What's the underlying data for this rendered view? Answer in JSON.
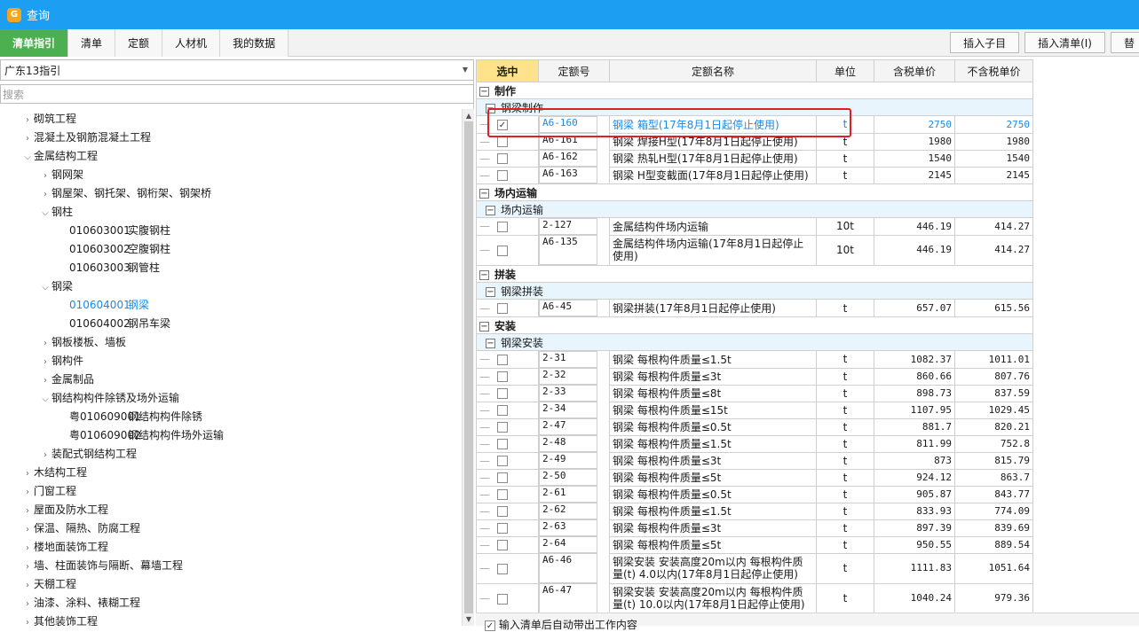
{
  "window": {
    "title": "查询"
  },
  "tabs": [
    "清单指引",
    "清单",
    "定额",
    "人材机",
    "我的数据"
  ],
  "toolbar": {
    "insert_child": "插入子目",
    "insert_list": "插入清单(I)",
    "replace": "替"
  },
  "left": {
    "region": "广东13指引",
    "search_placeholder": "搜索",
    "tree": [
      {
        "label": "砌筑工程",
        "level": 0,
        "expand": "collapsed"
      },
      {
        "label": "混凝土及钢筋混凝土工程",
        "level": 0,
        "expand": "collapsed"
      },
      {
        "label": "金属结构工程",
        "level": 0,
        "expand": "expanded"
      },
      {
        "label": "钢网架",
        "level": 1,
        "expand": "collapsed"
      },
      {
        "label": "钢屋架、钢托架、钢桁架、钢架桥",
        "level": 1,
        "expand": "collapsed"
      },
      {
        "label": "钢柱",
        "level": 1,
        "expand": "expanded"
      },
      {
        "code": "010603001",
        "label": "实腹钢柱",
        "level": 2,
        "expand": "none"
      },
      {
        "code": "010603002",
        "label": "空腹钢柱",
        "level": 2,
        "expand": "none"
      },
      {
        "code": "010603003",
        "label": "钢管柱",
        "level": 2,
        "expand": "none"
      },
      {
        "label": "钢梁",
        "level": 1,
        "expand": "expanded"
      },
      {
        "code": "010604001",
        "label": "钢梁",
        "level": 2,
        "expand": "none",
        "selected": true
      },
      {
        "code": "010604002",
        "label": "钢吊车梁",
        "level": 2,
        "expand": "none"
      },
      {
        "label": "钢板楼板、墙板",
        "level": 1,
        "expand": "collapsed"
      },
      {
        "label": "钢构件",
        "level": 1,
        "expand": "collapsed"
      },
      {
        "label": "金属制品",
        "level": 1,
        "expand": "collapsed"
      },
      {
        "label": "钢结构构件除锈及场外运输",
        "level": 1,
        "expand": "expanded"
      },
      {
        "code": "粤010609001",
        "label": "钢结构构件除锈",
        "level": 2,
        "expand": "none"
      },
      {
        "code": "粤010609002",
        "label": "钢结构构件场外运输",
        "level": 2,
        "expand": "none"
      },
      {
        "label": "装配式钢结构工程",
        "level": 1,
        "expand": "collapsed"
      },
      {
        "label": "木结构工程",
        "level": 0,
        "expand": "collapsed"
      },
      {
        "label": "门窗工程",
        "level": 0,
        "expand": "collapsed"
      },
      {
        "label": "屋面及防水工程",
        "level": 0,
        "expand": "collapsed"
      },
      {
        "label": "保温、隔热、防腐工程",
        "level": 0,
        "expand": "collapsed"
      },
      {
        "label": "楼地面装饰工程",
        "level": 0,
        "expand": "collapsed"
      },
      {
        "label": "墙、柱面装饰与隔断、幕墙工程",
        "level": 0,
        "expand": "collapsed"
      },
      {
        "label": "天棚工程",
        "level": 0,
        "expand": "collapsed"
      },
      {
        "label": "油漆、涂料、裱糊工程",
        "level": 0,
        "expand": "collapsed"
      },
      {
        "label": "其他装饰工程",
        "level": 0,
        "expand": "collapsed"
      }
    ]
  },
  "grid": {
    "headers": [
      "选中",
      "定额号",
      "定额名称",
      "单位",
      "含税单价",
      "不含税单价"
    ],
    "rows": [
      {
        "kind": "cat",
        "label": "制作"
      },
      {
        "kind": "sub",
        "label": "钢梁制作"
      },
      {
        "kind": "item",
        "checked": true,
        "hit": true,
        "code": "A6-160",
        "name": "钢梁 箱型(17年8月1日起停止使用)",
        "unit": "t",
        "p1": "2750",
        "p2": "2750"
      },
      {
        "kind": "item",
        "checked": false,
        "code": "A6-161",
        "name": "钢梁 焊接H型(17年8月1日起停止使用)",
        "unit": "t",
        "p1": "1980",
        "p2": "1980"
      },
      {
        "kind": "item",
        "checked": false,
        "code": "A6-162",
        "name": "钢梁 热轧H型(17年8月1日起停止使用)",
        "unit": "t",
        "p1": "1540",
        "p2": "1540"
      },
      {
        "kind": "item",
        "checked": false,
        "code": "A6-163",
        "name": "钢梁 H型变截面(17年8月1日起停止使用)",
        "unit": "t",
        "p1": "2145",
        "p2": "2145"
      },
      {
        "kind": "cat",
        "label": "场内运输"
      },
      {
        "kind": "sub",
        "label": "场内运输"
      },
      {
        "kind": "item",
        "checked": false,
        "code": "2-127",
        "name": "金属结构件场内运输",
        "unit": "10t",
        "p1": "446.19",
        "p2": "414.27"
      },
      {
        "kind": "item",
        "tall": true,
        "checked": false,
        "code": "A6-135",
        "name": "金属结构件场内运输(17年8月1日起停止使用)",
        "unit": "10t",
        "p1": "446.19",
        "p2": "414.27"
      },
      {
        "kind": "cat",
        "label": "拼装"
      },
      {
        "kind": "sub",
        "label": "钢梁拼装"
      },
      {
        "kind": "item",
        "checked": false,
        "code": "A6-45",
        "name": "钢梁拼装(17年8月1日起停止使用)",
        "unit": "t",
        "p1": "657.07",
        "p2": "615.56"
      },
      {
        "kind": "cat",
        "label": "安装"
      },
      {
        "kind": "sub",
        "label": "钢梁安装"
      },
      {
        "kind": "item",
        "checked": false,
        "code": "2-31",
        "name": "钢梁 每根构件质量≤1.5t",
        "unit": "t",
        "p1": "1082.37",
        "p2": "1011.01"
      },
      {
        "kind": "item",
        "checked": false,
        "code": "2-32",
        "name": "钢梁 每根构件质量≤3t",
        "unit": "t",
        "p1": "860.66",
        "p2": "807.76"
      },
      {
        "kind": "item",
        "checked": false,
        "code": "2-33",
        "name": "钢梁 每根构件质量≤8t",
        "unit": "t",
        "p1": "898.73",
        "p2": "837.59"
      },
      {
        "kind": "item",
        "checked": false,
        "code": "2-34",
        "name": "钢梁 每根构件质量≤15t",
        "unit": "t",
        "p1": "1107.95",
        "p2": "1029.45"
      },
      {
        "kind": "item",
        "checked": false,
        "code": "2-47",
        "name": "钢梁 每根构件质量≤0.5t",
        "unit": "t",
        "p1": "881.7",
        "p2": "820.21"
      },
      {
        "kind": "item",
        "checked": false,
        "code": "2-48",
        "name": "钢梁 每根构件质量≤1.5t",
        "unit": "t",
        "p1": "811.99",
        "p2": "752.8"
      },
      {
        "kind": "item",
        "checked": false,
        "code": "2-49",
        "name": "钢梁 每根构件质量≤3t",
        "unit": "t",
        "p1": "873",
        "p2": "815.79"
      },
      {
        "kind": "item",
        "checked": false,
        "code": "2-50",
        "name": "钢梁 每根构件质量≤5t",
        "unit": "t",
        "p1": "924.12",
        "p2": "863.7"
      },
      {
        "kind": "item",
        "checked": false,
        "code": "2-61",
        "name": "钢梁 每根构件质量≤0.5t",
        "unit": "t",
        "p1": "905.87",
        "p2": "843.77"
      },
      {
        "kind": "item",
        "checked": false,
        "code": "2-62",
        "name": "钢梁 每根构件质量≤1.5t",
        "unit": "t",
        "p1": "833.93",
        "p2": "774.09"
      },
      {
        "kind": "item",
        "checked": false,
        "code": "2-63",
        "name": "钢梁 每根构件质量≤3t",
        "unit": "t",
        "p1": "897.39",
        "p2": "839.69"
      },
      {
        "kind": "item",
        "checked": false,
        "code": "2-64",
        "name": "钢梁 每根构件质量≤5t",
        "unit": "t",
        "p1": "950.55",
        "p2": "889.54"
      },
      {
        "kind": "item",
        "tall": true,
        "checked": false,
        "code": "A6-46",
        "name": "钢梁安装 安装高度20m以内 每根构件质量(t) 4.0以内(17年8月1日起停止使用)",
        "unit": "t",
        "p1": "1111.83",
        "p2": "1051.64"
      },
      {
        "kind": "item",
        "tall": true,
        "checked": false,
        "code": "A6-47",
        "name": "钢梁安装 安装高度20m以内 每根构件质量(t) 10.0以内(17年8月1日起停止使用)",
        "unit": "t",
        "p1": "1040.24",
        "p2": "979.36"
      }
    ]
  },
  "bottom": {
    "auto_option": "输入清单后自动带出工作内容"
  },
  "colors": {
    "titlebar": "#1c9ef2",
    "active_tab": "#4caf50",
    "selected_text": "#1a8ae6",
    "highlight_border": "#e02020"
  }
}
